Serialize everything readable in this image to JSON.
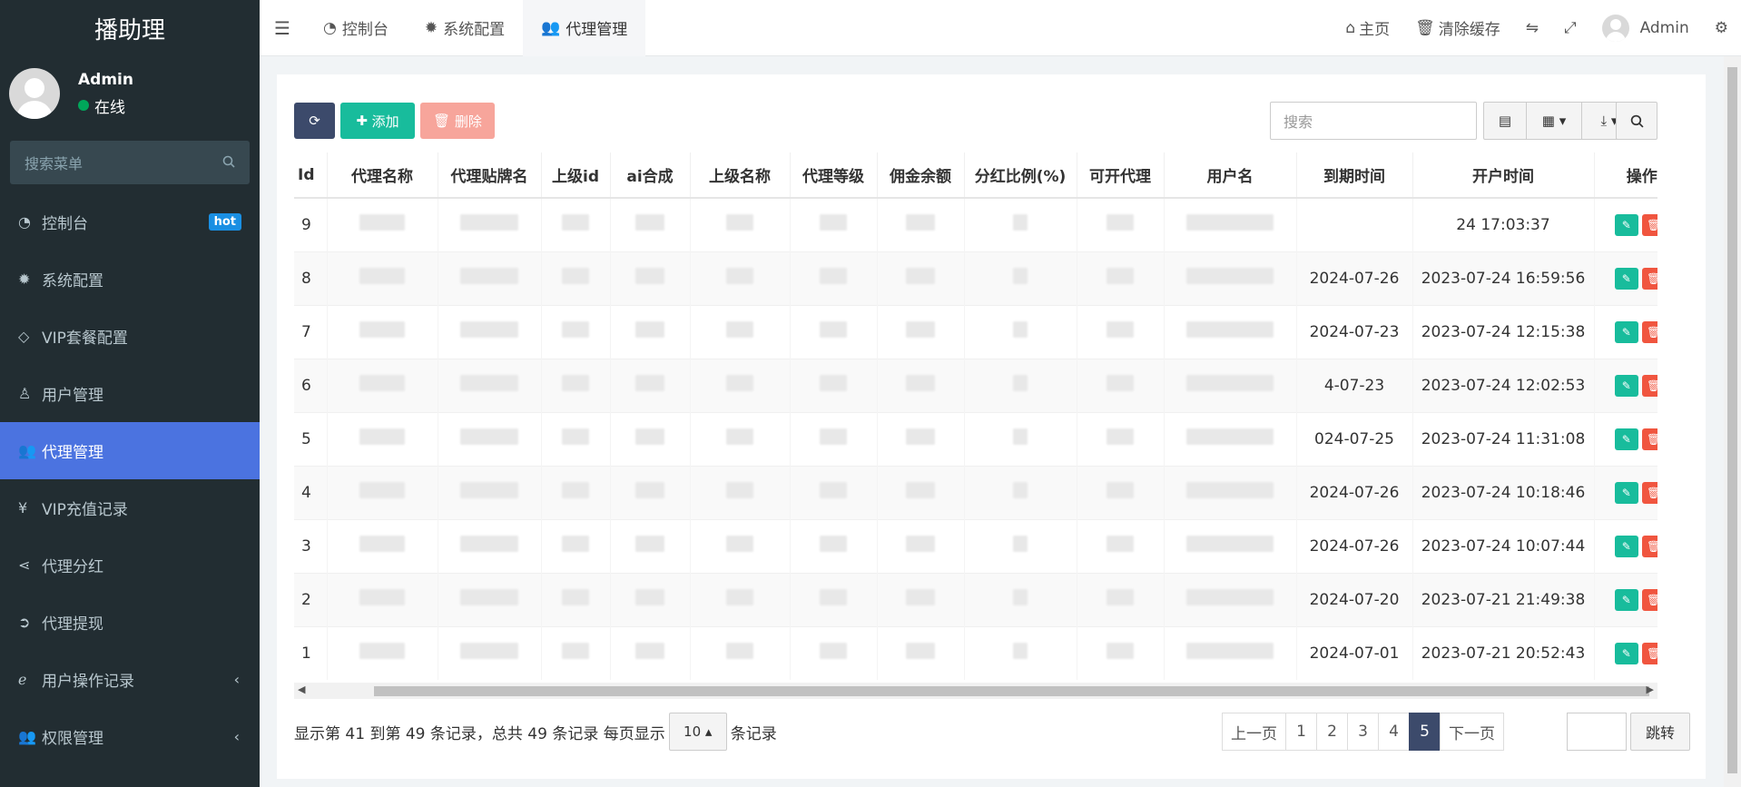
{
  "app_title": "播助理",
  "user": {
    "name": "Admin",
    "status": "在线"
  },
  "sidebar": {
    "search_placeholder": "搜索菜单",
    "items": [
      {
        "label": "控制台",
        "icon": "dashboard-icon",
        "badge": "hot"
      },
      {
        "label": "系统配置",
        "icon": "gear-icon"
      },
      {
        "label": "VIP套餐配置",
        "icon": "diamond-icon"
      },
      {
        "label": "用户管理",
        "icon": "user-icon"
      },
      {
        "label": "代理管理",
        "icon": "users-icon",
        "active": true
      },
      {
        "label": "VIP充值记录",
        "icon": "yen-icon"
      },
      {
        "label": "代理分红",
        "icon": "share-icon"
      },
      {
        "label": "代理提现",
        "icon": "arrow-circle-icon"
      },
      {
        "label": "用户操作记录",
        "icon": "ie-icon",
        "expandable": true
      },
      {
        "label": "权限管理",
        "icon": "users-icon",
        "expandable": true
      }
    ]
  },
  "topbar": {
    "tabs": [
      {
        "label": "控制台",
        "icon": "dashboard-icon"
      },
      {
        "label": "系统配置",
        "icon": "gear-icon"
      },
      {
        "label": "代理管理",
        "icon": "users-icon",
        "active": true
      }
    ],
    "home": "主页",
    "clear_cache": "清除缓存",
    "admin": "Admin"
  },
  "toolbar": {
    "add": "添加",
    "delete": "删除",
    "search_placeholder": "搜索"
  },
  "table": {
    "columns": [
      "Id",
      "代理名称",
      "代理贴牌名",
      "上级id",
      "ai合成",
      "上级名称",
      "代理等级",
      "佣金余额",
      "分红比例(%)",
      "可开代理",
      "用户名",
      "到期时间",
      "开户时间",
      "操作"
    ],
    "rows": [
      {
        "id": "9",
        "expire": "",
        "created": "24 17:03:37"
      },
      {
        "id": "8",
        "expire": "2024-07-26",
        "created": "2023-07-24 16:59:56"
      },
      {
        "id": "7",
        "expire": "2024-07-23",
        "created": "2023-07-24 12:15:38"
      },
      {
        "id": "6",
        "expire": "4-07-23",
        "created": "2023-07-24 12:02:53"
      },
      {
        "id": "5",
        "expire": "024-07-25",
        "created": "2023-07-24 11:31:08"
      },
      {
        "id": "4",
        "expire": "2024-07-26",
        "created": "2023-07-24 10:18:46"
      },
      {
        "id": "3",
        "expire": "2024-07-26",
        "created": "2023-07-24 10:07:44"
      },
      {
        "id": "2",
        "expire": "2024-07-20",
        "created": "2023-07-21 21:49:38"
      },
      {
        "id": "1",
        "expire": "2024-07-01",
        "created": "2023-07-21 20:52:43"
      }
    ]
  },
  "footer": {
    "info": "显示第 41 到第 49 条记录，总共 49 条记录 每页显示",
    "page_size": "10",
    "suffix": "条记录",
    "prev": "上一页",
    "next": "下一页",
    "pages": [
      "1",
      "2",
      "3",
      "4",
      "5"
    ],
    "current_page": "5",
    "jump": "跳转"
  }
}
